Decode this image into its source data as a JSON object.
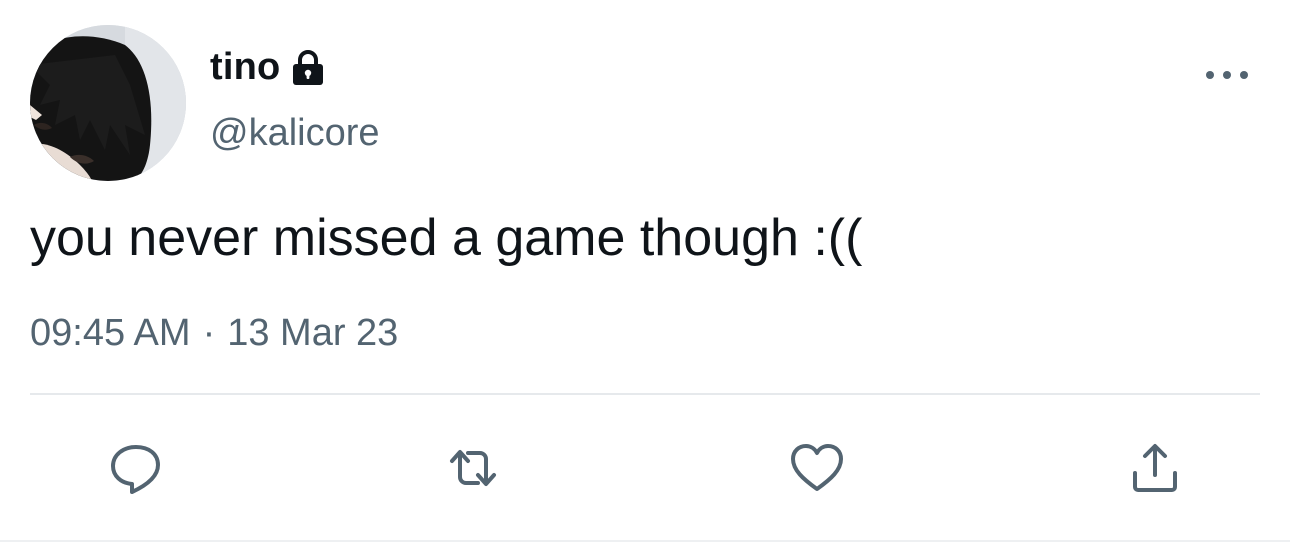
{
  "tweet": {
    "display_name": "tino",
    "handle": "@kalicore",
    "text": "you never missed a game though :((",
    "time": "09:45 AM",
    "separator": "·",
    "date": "13 Mar 23"
  },
  "icons": {
    "protected": "lock-icon",
    "more": "more-horizontal-icon",
    "reply": "reply-icon",
    "retweet": "retweet-icon",
    "like": "heart-icon",
    "share": "share-icon"
  },
  "colors": {
    "text": "#0f1419",
    "secondary": "#536471",
    "divider": "#e6e9ec",
    "background": "#ffffff"
  }
}
